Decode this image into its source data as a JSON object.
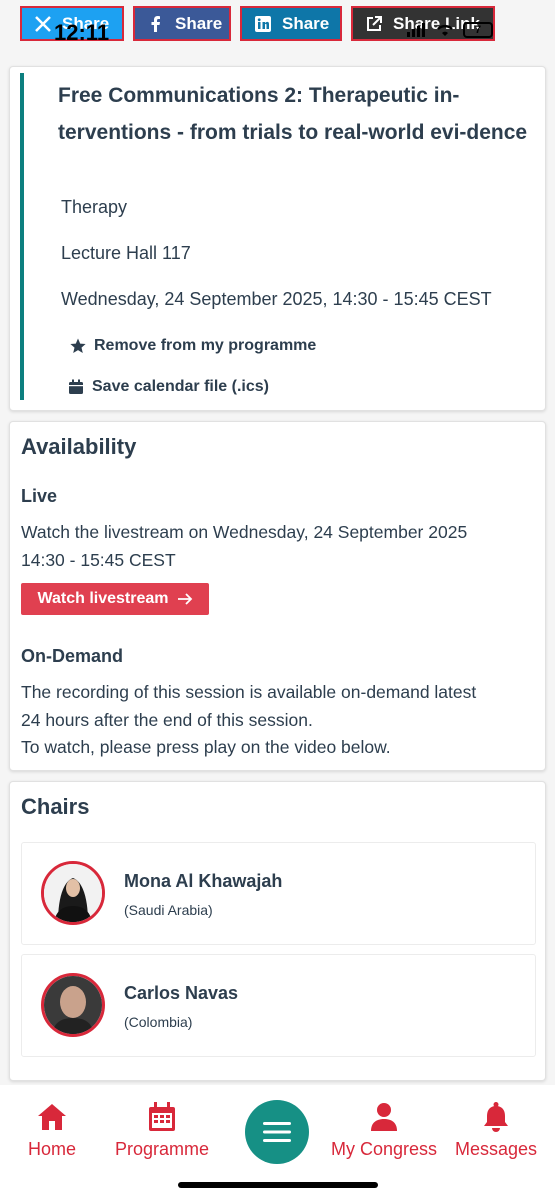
{
  "status_bar": {
    "time": "12:11",
    "battery": "7"
  },
  "share": {
    "x_label": "Share",
    "facebook_label": "Share",
    "linkedin_label": "Share",
    "link_label": "Share Link"
  },
  "session": {
    "title": "Free Communications 2: Therapeutic in-terventions - from trials to real-world evi-dence",
    "category": "Therapy",
    "location": "Lecture Hall 117",
    "datetime": "Wednesday, 24 September 2025, 14:30 - 15:45 CEST",
    "remove_label": "Remove from my programme",
    "calendar_label": "Save calendar file (.ics)"
  },
  "availability": {
    "heading": "Availability",
    "live_heading": "Live",
    "live_text_1": "Watch the livestream on Wednesday, 24 September 2025",
    "live_text_2": "14:30 - 15:45 CEST",
    "watch_label": "Watch livestream",
    "ondemand_heading": "On-Demand",
    "ondemand_text_1": "The recording of this session is available on-demand latest",
    "ondemand_text_2": "24 hours after the end of this session.",
    "ondemand_text_3": "To watch, please press play on the video below."
  },
  "chairs": {
    "heading": "Chairs",
    "people": [
      {
        "name": "Mona Al Khawajah",
        "country": "(Saudi Arabia)"
      },
      {
        "name": "Carlos Navas",
        "country": "(Colombia)"
      }
    ]
  },
  "nav": {
    "home": "Home",
    "programme": "Programme",
    "my_congress": "My Congress",
    "messages": "Messages"
  },
  "colors": {
    "accent_red": "#d8283a",
    "teal": "#169085",
    "text": "#2d3e4e"
  }
}
